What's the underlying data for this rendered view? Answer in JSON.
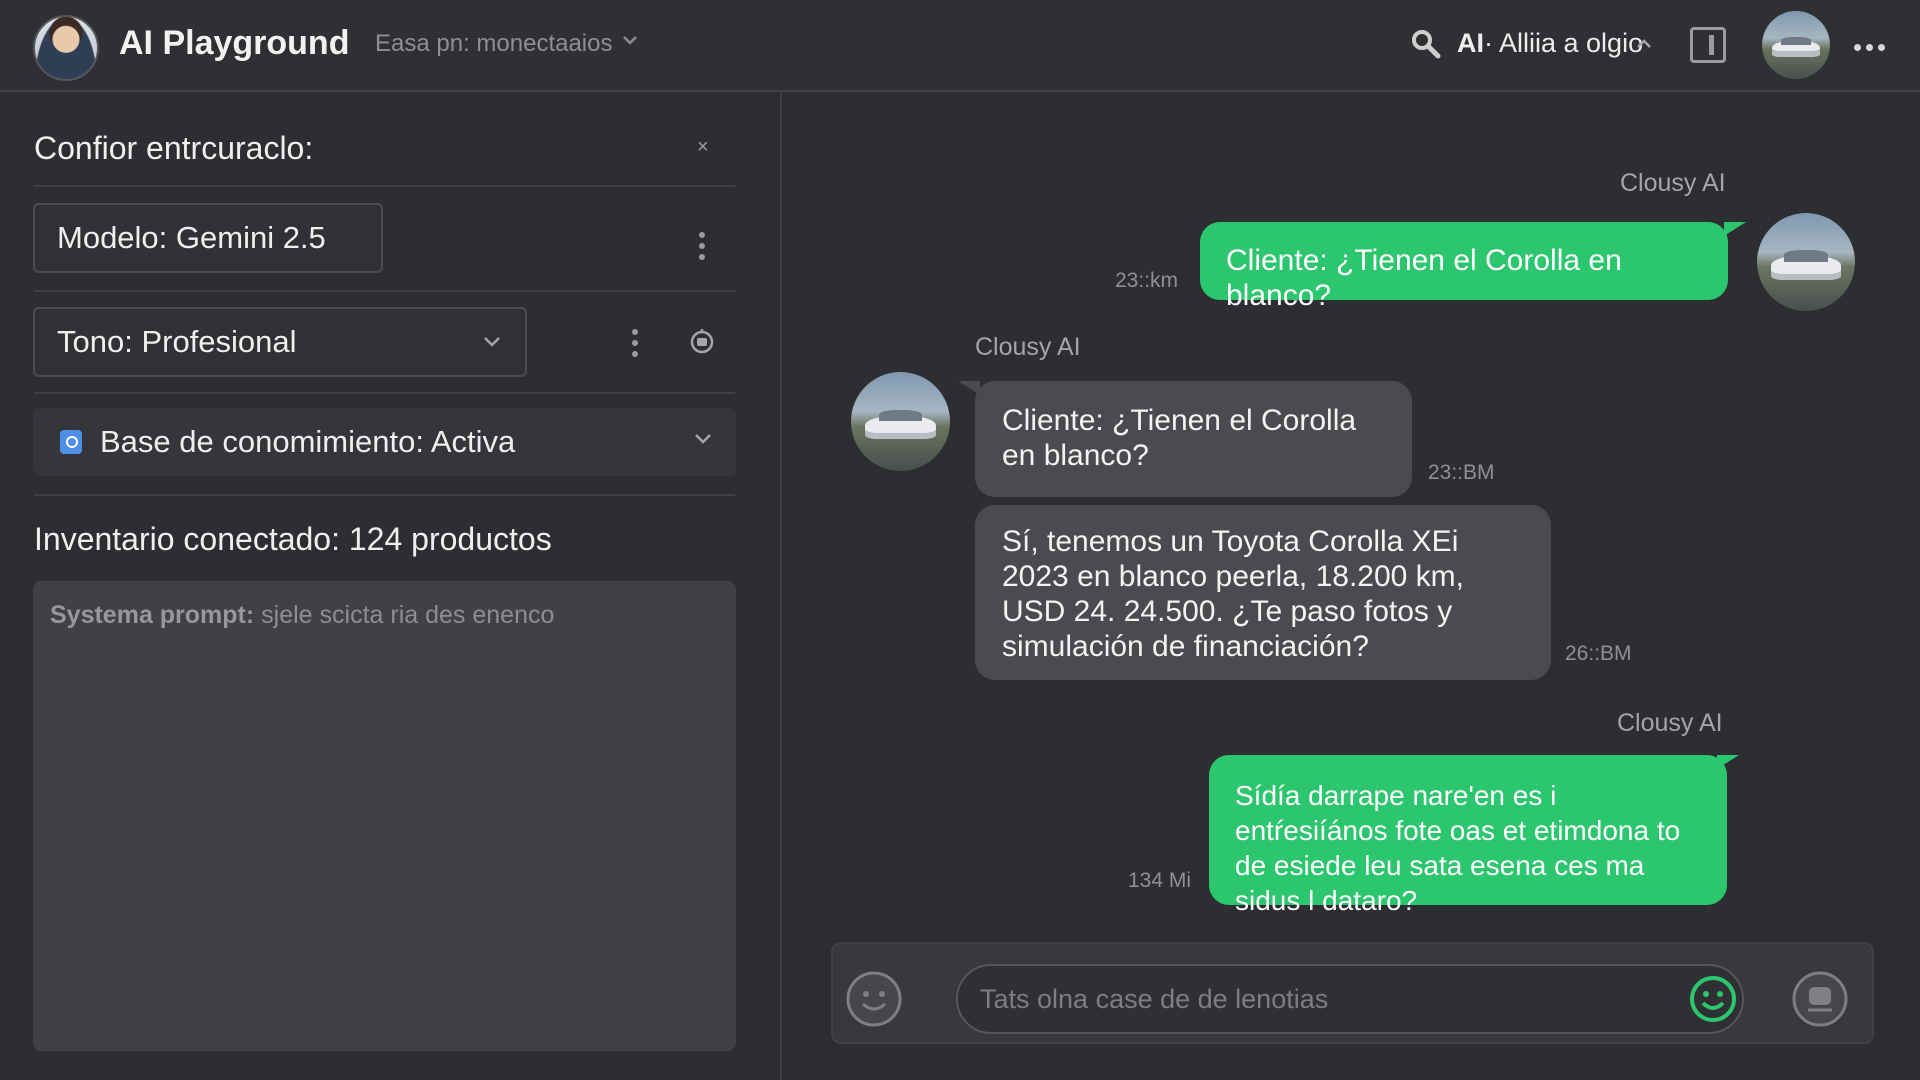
{
  "header": {
    "app_title": "AI Playground",
    "workspace_label": "Easa pn: monectaaios",
    "model_selector_bold": "AI",
    "model_selector_rest": "· Alliia a olgio"
  },
  "config_panel": {
    "heading": "Confior entrcuraclo:",
    "close_label": "×",
    "model_field": "Modelo: Gemini 2.5",
    "tone_field": "Tono: Profesional",
    "knowledge_base": "Base de conomimiento: Activa",
    "inventory": "Inventario conectado: 124 productos",
    "system_prompt_label": "Systema prompt:",
    "system_prompt_text": "sjele scicta ria des enenco"
  },
  "chat": {
    "messages": [
      {
        "sender": "Clousy AI",
        "direction": "outgoing",
        "text": "Cliente: ¿Tienen el Corolla en blanco?",
        "time": "23::km"
      },
      {
        "sender": "Clousy AI",
        "direction": "incoming",
        "text": "Cliente: ¿Tienen el Corolla en blanco?",
        "time": "23::BM"
      },
      {
        "sender": "",
        "direction": "incoming",
        "text": "Sí, tenemos un Toyota Corolla XEi 2023 en blanco peerla, 18.200 km, USD 24. 24.500. ¿Te paso fotos y simulación de financiación?",
        "time": "26::BM"
      },
      {
        "sender": "Clousy AI",
        "direction": "outgoing",
        "text": "Sídía darrape nare'en es i entŕesiíános fote oas et etimdona to de esiede leu sata esena ces ma sidus l dataro?",
        "time": "134 Mi"
      }
    ],
    "composer_placeholder": "Tats olna case de de lenotias"
  },
  "icons": {
    "search": "search-icon",
    "chevron": "chevron-down-icon",
    "panel": "panel-toggle-icon",
    "more": "more-horizontal-icon",
    "kebab": "kebab-menu-icon",
    "bot": "robot-icon",
    "knowledge": "database-badge-icon",
    "emoji": "smiley-icon",
    "send": "smiley-green-icon"
  },
  "colors": {
    "background": "#2d2e31",
    "accent_green": "#2cc66e",
    "incoming_bubble": "#4a4b4f",
    "kb_badge": "#4e8fe8"
  }
}
